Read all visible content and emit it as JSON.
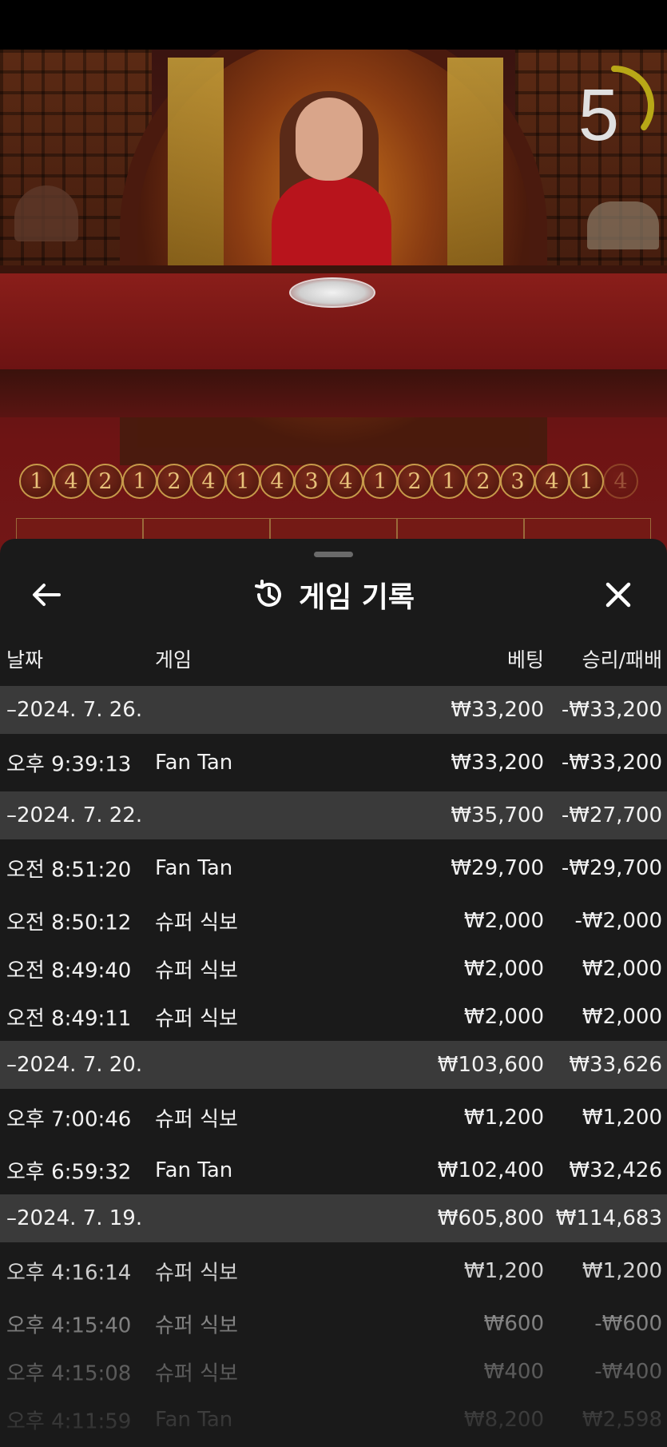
{
  "timer": {
    "value": "5",
    "progress": 0.35
  },
  "roadmap": [
    "1",
    "4",
    "2",
    "1",
    "2",
    "4",
    "1",
    "4",
    "3",
    "4",
    "1",
    "2",
    "1",
    "2",
    "3",
    "4",
    "1",
    "4"
  ],
  "sheet": {
    "title": "게임 기록",
    "icons": {
      "back": "arrow-left-icon",
      "history": "history-icon",
      "close": "close-icon"
    }
  },
  "columns": {
    "date": "날짜",
    "game": "게임",
    "bet": "베팅",
    "result": "승리/패배"
  },
  "groups": [
    {
      "date": "–2024. 7. 26.",
      "bet": "₩33,200",
      "result": "-₩33,200",
      "items": [
        {
          "time": "오후 9:39:13",
          "game": "Fan Tan",
          "bet": "₩33,200",
          "result": "-₩33,200"
        }
      ]
    },
    {
      "date": "–2024. 7. 22.",
      "bet": "₩35,700",
      "result": "-₩27,700",
      "items": [
        {
          "time": "오전 8:51:20",
          "game": "Fan Tan",
          "bet": "₩29,700",
          "result": "-₩29,700"
        },
        {
          "time": "오전 8:50:12",
          "game": "슈퍼 식보",
          "bet": "₩2,000",
          "result": "-₩2,000"
        },
        {
          "time": "오전 8:49:40",
          "game": "슈퍼 식보",
          "bet": "₩2,000",
          "result": "₩2,000"
        },
        {
          "time": "오전 8:49:11",
          "game": "슈퍼 식보",
          "bet": "₩2,000",
          "result": "₩2,000"
        }
      ]
    },
    {
      "date": "–2024. 7. 20.",
      "bet": "₩103,600",
      "result": "₩33,626",
      "items": [
        {
          "time": "오후 7:00:46",
          "game": "슈퍼 식보",
          "bet": "₩1,200",
          "result": "₩1,200"
        },
        {
          "time": "오후 6:59:32",
          "game": "Fan Tan",
          "bet": "₩102,400",
          "result": "₩32,426"
        }
      ]
    },
    {
      "date": "–2024. 7. 19.",
      "bet": "₩605,800",
      "result": "₩114,683",
      "items": [
        {
          "time": "오후 4:16:14",
          "game": "슈퍼 식보",
          "bet": "₩1,200",
          "result": "₩1,200"
        },
        {
          "time": "오후 4:15:40",
          "game": "슈퍼 식보",
          "bet": "₩600",
          "result": "-₩600"
        },
        {
          "time": "오후 4:15:08",
          "game": "슈퍼 식보",
          "bet": "₩400",
          "result": "-₩400"
        },
        {
          "time": "오후 4:11:59",
          "game": "Fan Tan",
          "bet": "₩8,200",
          "result": "₩2,598"
        }
      ]
    }
  ],
  "colors": {
    "sheet_bg": "#1a1a1a",
    "group_bg": "#3a3a3a",
    "accent_gold": "#c79a4a",
    "timer_ring": "#b8a817"
  }
}
